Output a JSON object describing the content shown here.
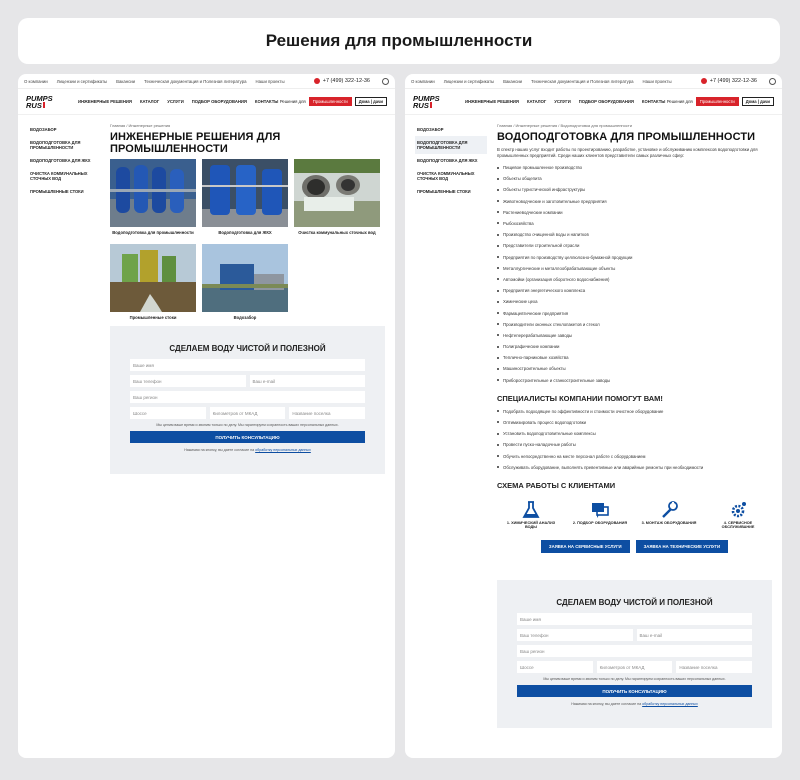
{
  "page_title": "Решения для промышленности",
  "topbar": {
    "links": [
      "О компании",
      "Лицензии и сертификаты",
      "Вакансии",
      "Техническая документация и Полезная литература",
      "Наши проекты"
    ],
    "phone": "+7 (499) 322-12-36"
  },
  "header": {
    "logo_line1": "PUMPS",
    "logo_line2": "RUS",
    "nav": [
      "Инженерные решения",
      "Каталог",
      "Услуги",
      "Подбор оборудования",
      "Контакты"
    ],
    "segment_label": "Решения для",
    "segment_active": "Промышленности",
    "segment_pill": "Дома | дачи"
  },
  "sidebar": {
    "items": [
      "Водозабор",
      "Водоподготовка для промышленности",
      "Водоподготовка для ЖКХ",
      "Очистка коммунальных сточных вод",
      "Промышленные стоки"
    ]
  },
  "left": {
    "breadcrumb": "Главная / Инженерные решения",
    "heading": "Инженерные решения для промышленности",
    "cards": [
      "Водоподготовка для промышленности",
      "Водоподготовка для ЖКХ",
      "Очистка коммунальных сточных вод",
      "Промышленные стоки",
      "Водозабор"
    ]
  },
  "form": {
    "heading": "Сделаем воду чистой и полезной",
    "name": "Ваше имя",
    "phone": "Ваш телефон",
    "email": "Ваш e-mail",
    "region": "Ваш регион",
    "road": "Шоссе",
    "km": "Километров от МКАД",
    "village": "Название поселка",
    "note": "Мы ценим ваше время и звоним только по делу. Мы гарантируем сохранность ваших персональных данных.",
    "button": "Получить консультацию",
    "agree_prefix": "Нажимая на кнопку, вы даете согласие на",
    "agree_link": "обработку персональных данных"
  },
  "right": {
    "breadcrumb": "Главная / Инженерные решения / Водоподготовка для промышленности",
    "heading": "Водоподготовка для промышленности",
    "intro": "В спектр наших услуг входит работы по проектированию, разработке, установке и обслуживанию комплексов водоподготовки для промышленных предприятий. Среди наших клиентов представители самых различных сфер:",
    "clients": [
      "Пищевое промышленное производство",
      "Объекты общепита",
      "Объекты туристической инфраструктуры",
      "Животноводческие и заготовительные предприятия",
      "Растениеводческие компании",
      "Рыбохозяйства",
      "Производство очищенной воды и напитков",
      "Представители строительной отрасли",
      "Предприятия по производству целлюлозно-бумажной продукции",
      "Металлургические и металлообрабатывающие объекты",
      "Автомойки (организация оборотного водоснабжения)",
      "Предприятия энергетического комплекса",
      "Химические цеха",
      "Фармацевтические предприятия",
      "Производители оконных стеклопакетов и стекол",
      "Нефтеперерабатывающие заводы",
      "Полиграфические компании",
      "Теплично-парниковые хозяйства",
      "Машиностроительные объекты",
      "Приборостроительные и станкостроительные заводы"
    ],
    "specialists_heading": "Специалисты компании помогут вам!",
    "specialists": [
      "Подобрать подходящее по эффективности и стоимости очистное оборудование",
      "Оптимизировать процесс водоподготовки",
      "Установить водоподготовительные комплексы",
      "Провести пуско-наладочные работы",
      "Обучить непосредственно на месте персонал работе с оборудованием",
      "Обслуживать оборудование, выполнять превентивные или аварийные ремонты при необходимости"
    ],
    "scheme_heading": "Схема работы с клиентами",
    "steps": [
      "1. Химический анализ воды",
      "2. Подбор оборудования",
      "3. Монтаж оборудования",
      "4. Сервисное обслуживание"
    ],
    "btn_service": "Заявка на сервисные услуги",
    "btn_tech": "Заявка на технические услуги"
  }
}
